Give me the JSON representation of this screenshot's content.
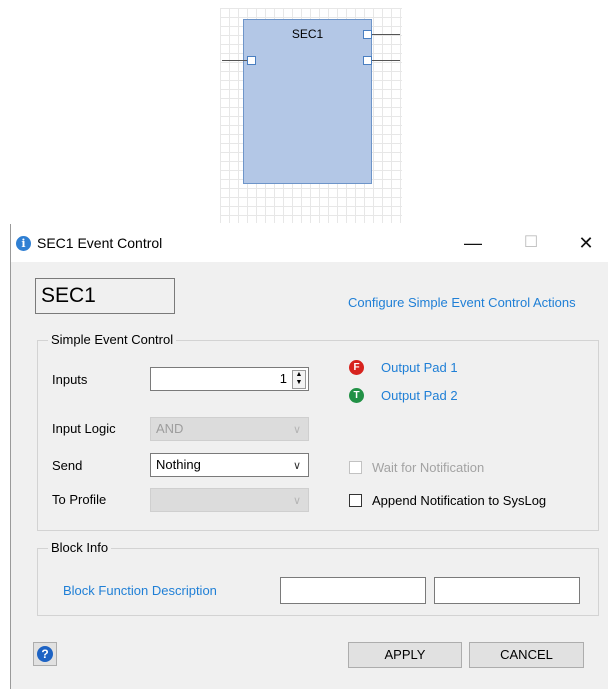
{
  "diagram": {
    "block_title": "SEC1"
  },
  "window": {
    "title": "SEC1 Event Control",
    "minimize_glyph": "—",
    "maximize_glyph": "☐",
    "close_glyph": "✕",
    "icon": "info-icon"
  },
  "header": {
    "name_value": "SEC1",
    "config_link": "Configure Simple Event Control Actions"
  },
  "simple_event_control": {
    "legend": "Simple Event Control",
    "inputs_label": "Inputs",
    "inputs_value": "1",
    "input_logic_label": "Input Logic",
    "input_logic_value": "AND",
    "send_label": "Send",
    "send_value": "Nothing",
    "to_profile_label": "To Profile",
    "to_profile_value": "",
    "output_pad_1": {
      "badge": "F",
      "label": "Output Pad 1",
      "color": "#d7231e"
    },
    "output_pad_2": {
      "badge": "T",
      "label": "Output Pad 2",
      "color": "#229146"
    },
    "wait_for_notification": {
      "label": "Wait for Notification",
      "checked": false,
      "enabled": false
    },
    "append_syslog": {
      "label": "Append Notification to SysLog",
      "checked": false,
      "enabled": true
    }
  },
  "block_info": {
    "legend": "Block Info",
    "function_link": "Block Function Description",
    "field1_value": "",
    "field2_value": ""
  },
  "footer": {
    "apply_label": "APPLY",
    "cancel_label": "CANCEL",
    "help_glyph": "?"
  },
  "colors": {
    "link": "#1f7fd6",
    "block_fill": "#b3c7e6",
    "help": "#1d63c4"
  }
}
